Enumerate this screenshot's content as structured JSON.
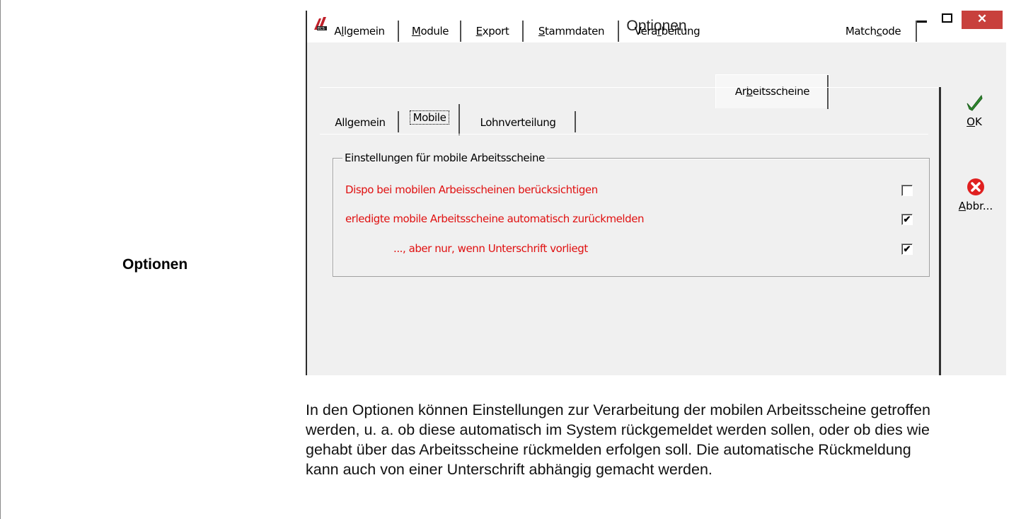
{
  "side_heading": "Optionen",
  "window": {
    "title": "Optionen",
    "close_glyph": "✕",
    "icon": "ecs-logo-icon"
  },
  "tabs": [
    {
      "pre": "A",
      "key": "l",
      "post": "lgemein"
    },
    {
      "pre": "",
      "key": "M",
      "post": "odule"
    },
    {
      "pre": "",
      "key": "E",
      "post": "xport"
    },
    {
      "pre": "",
      "key": "S",
      "post": "tammdaten"
    },
    {
      "pre": "Vera",
      "key": "r",
      "post": "beitung"
    },
    {
      "pre": "Ar",
      "key": "b",
      "post": "eitsscheine"
    },
    {
      "pre": "Match",
      "key": "c",
      "post": "ode"
    }
  ],
  "active_tab_index": 5,
  "sub_tabs": {
    "allgemein": "Allgemein",
    "mobile": "Mobile",
    "lohnverteilung": "Lohnverteilung"
  },
  "group": {
    "legend": "Einstellungen für mobile Arbeitsscheine",
    "options": [
      {
        "label": "Dispo bei mobilen Arbeisscheinen berücksichtigen",
        "checked": false,
        "mark": ""
      },
      {
        "label": "erledigte mobile Arbeitsscheine automatisch zurückmelden",
        "checked": true,
        "mark": "✔"
      },
      {
        "label": "..., aber nur, wenn Unterschrift vorliegt",
        "checked": true,
        "mark": "✔"
      }
    ]
  },
  "buttons": {
    "ok": {
      "key": "O",
      "post": "K",
      "icon": "checkmark-icon",
      "color": "#2e8b2e"
    },
    "cancel": {
      "key": "A",
      "post": "bbr...",
      "icon": "red-x-circle-icon",
      "color": "#e02020"
    }
  },
  "description": "In den Optionen können Einstellungen zur Verarbeitung der mobilen Arbeitsscheine getroffen werden, u. a. ob diese automatisch im System rückgemeldet werden sollen, oder ob dies wie gehabt über das Arbeitsscheine rückmelden erfolgen soll. Die automatische Rückmeldung kann auch von einer Unterschrift abhängig gemacht werden."
}
